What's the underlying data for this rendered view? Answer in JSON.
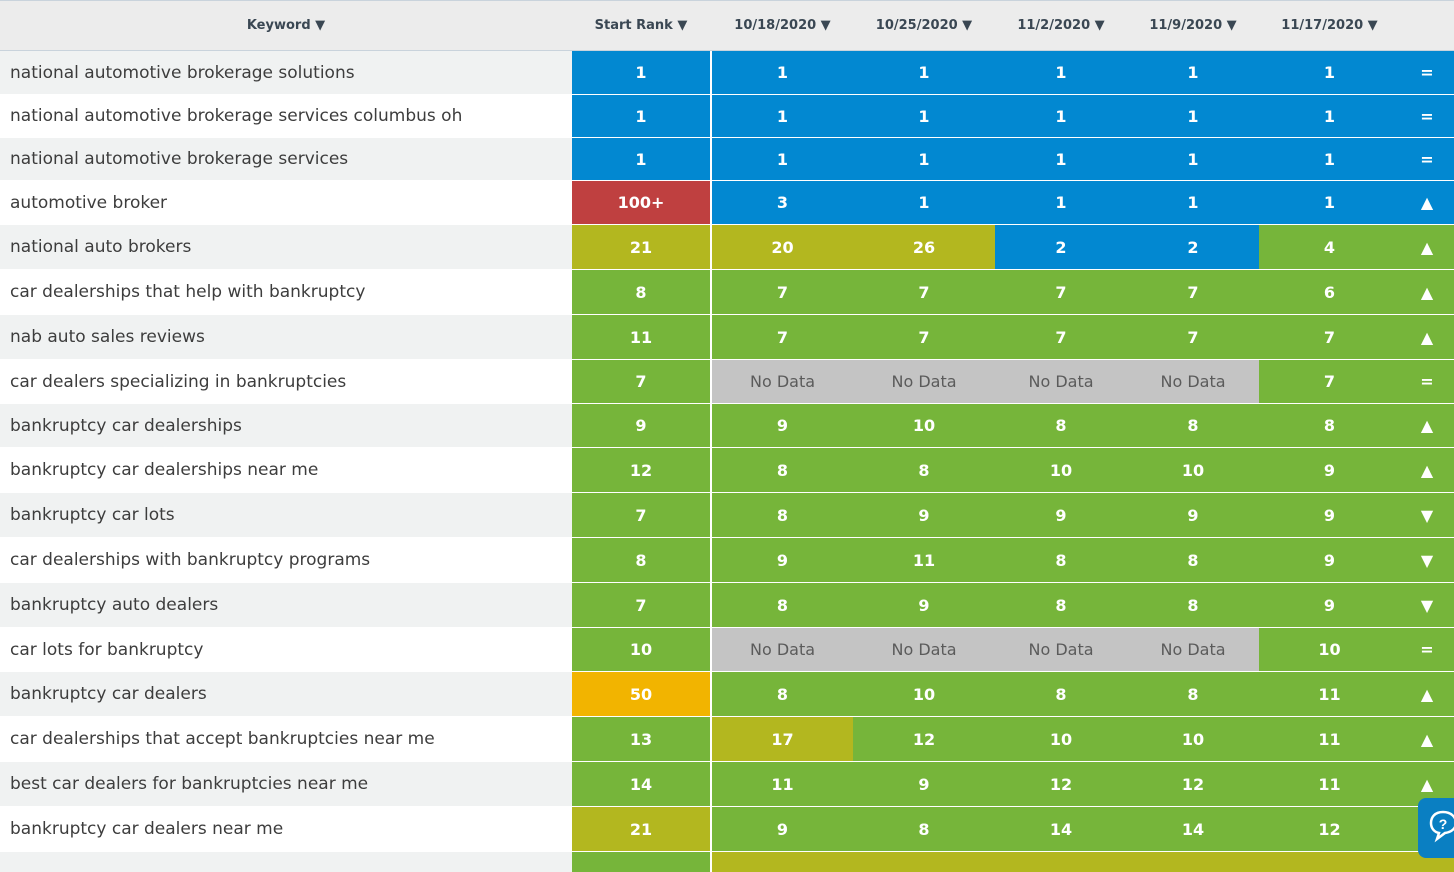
{
  "header": {
    "keyword": "Keyword ▼",
    "start_rank": "Start Rank ▼",
    "dates": [
      "10/18/2020 ▼",
      "10/25/2020 ▼",
      "11/2/2020 ▼",
      "11/9/2020 ▼",
      "11/17/2020 ▼"
    ]
  },
  "colors": {
    "blue": "#0288d1",
    "green": "#76b53a",
    "olive": "#b3b71f",
    "red": "#bf4040",
    "orange": "#f2b400",
    "gray": "#c4c4c4",
    "row_odd": "#f0f2f2",
    "row_even": "#ffffff"
  },
  "rows": [
    {
      "keyword": "national automotive brokerage solutions",
      "values": [
        "1",
        "1",
        "1",
        "1",
        "1",
        "1"
      ],
      "colors": [
        "blue",
        "blue",
        "blue",
        "blue",
        "blue",
        "blue"
      ],
      "trend": "=",
      "trend_color": "blue"
    },
    {
      "keyword": "national automotive brokerage services columbus oh",
      "values": [
        "1",
        "1",
        "1",
        "1",
        "1",
        "1"
      ],
      "colors": [
        "blue",
        "blue",
        "blue",
        "blue",
        "blue",
        "blue"
      ],
      "trend": "=",
      "trend_color": "blue"
    },
    {
      "keyword": "national automotive brokerage services",
      "values": [
        "1",
        "1",
        "1",
        "1",
        "1",
        "1"
      ],
      "colors": [
        "blue",
        "blue",
        "blue",
        "blue",
        "blue",
        "blue"
      ],
      "trend": "=",
      "trend_color": "blue"
    },
    {
      "keyword": "automotive broker",
      "values": [
        "100+",
        "3",
        "1",
        "1",
        "1",
        "1"
      ],
      "colors": [
        "red",
        "blue",
        "blue",
        "blue",
        "blue",
        "blue"
      ],
      "trend": "▲",
      "trend_color": "blue"
    },
    {
      "keyword": "national auto brokers",
      "values": [
        "21",
        "20",
        "26",
        "2",
        "2",
        "4"
      ],
      "colors": [
        "olive",
        "olive",
        "olive",
        "blue",
        "blue",
        "green"
      ],
      "trend": "▲",
      "trend_color": "green"
    },
    {
      "keyword": "car dealerships that help with bankruptcy",
      "values": [
        "8",
        "7",
        "7",
        "7",
        "7",
        "6"
      ],
      "colors": [
        "green",
        "green",
        "green",
        "green",
        "green",
        "green"
      ],
      "trend": "▲",
      "trend_color": "green"
    },
    {
      "keyword": "nab auto sales reviews",
      "values": [
        "11",
        "7",
        "7",
        "7",
        "7",
        "7"
      ],
      "colors": [
        "green",
        "green",
        "green",
        "green",
        "green",
        "green"
      ],
      "trend": "▲",
      "trend_color": "green"
    },
    {
      "keyword": "car dealers specializing in bankruptcies",
      "values": [
        "7",
        "No Data",
        "No Data",
        "No Data",
        "No Data",
        "7"
      ],
      "colors": [
        "green",
        "gray",
        "gray",
        "gray",
        "gray",
        "green"
      ],
      "trend": "=",
      "trend_color": "green"
    },
    {
      "keyword": "bankruptcy car dealerships",
      "values": [
        "9",
        "9",
        "10",
        "8",
        "8",
        "8"
      ],
      "colors": [
        "green",
        "green",
        "green",
        "green",
        "green",
        "green"
      ],
      "trend": "▲",
      "trend_color": "green"
    },
    {
      "keyword": "bankruptcy car dealerships near me",
      "values": [
        "12",
        "8",
        "8",
        "10",
        "10",
        "9"
      ],
      "colors": [
        "green",
        "green",
        "green",
        "green",
        "green",
        "green"
      ],
      "trend": "▲",
      "trend_color": "green"
    },
    {
      "keyword": "bankruptcy car lots",
      "values": [
        "7",
        "8",
        "9",
        "9",
        "9",
        "9"
      ],
      "colors": [
        "green",
        "green",
        "green",
        "green",
        "green",
        "green"
      ],
      "trend": "▼",
      "trend_color": "green"
    },
    {
      "keyword": "car dealerships with bankruptcy programs",
      "values": [
        "8",
        "9",
        "11",
        "8",
        "8",
        "9"
      ],
      "colors": [
        "green",
        "green",
        "green",
        "green",
        "green",
        "green"
      ],
      "trend": "▼",
      "trend_color": "green"
    },
    {
      "keyword": "bankruptcy auto dealers",
      "values": [
        "7",
        "8",
        "9",
        "8",
        "8",
        "9"
      ],
      "colors": [
        "green",
        "green",
        "green",
        "green",
        "green",
        "green"
      ],
      "trend": "▼",
      "trend_color": "green"
    },
    {
      "keyword": "car lots for bankruptcy",
      "values": [
        "10",
        "No Data",
        "No Data",
        "No Data",
        "No Data",
        "10"
      ],
      "colors": [
        "green",
        "gray",
        "gray",
        "gray",
        "gray",
        "green"
      ],
      "trend": "=",
      "trend_color": "green"
    },
    {
      "keyword": "bankruptcy car dealers",
      "values": [
        "50",
        "8",
        "10",
        "8",
        "8",
        "11"
      ],
      "colors": [
        "orange",
        "green",
        "green",
        "green",
        "green",
        "green"
      ],
      "trend": "▲",
      "trend_color": "green"
    },
    {
      "keyword": "car dealerships that accept bankruptcies near me",
      "values": [
        "13",
        "17",
        "12",
        "10",
        "10",
        "11"
      ],
      "colors": [
        "green",
        "olive",
        "green",
        "green",
        "green",
        "green"
      ],
      "trend": "▲",
      "trend_color": "green"
    },
    {
      "keyword": "best car dealers for bankruptcies near me",
      "values": [
        "14",
        "11",
        "9",
        "12",
        "12",
        "11"
      ],
      "colors": [
        "green",
        "green",
        "green",
        "green",
        "green",
        "green"
      ],
      "trend": "▲",
      "trend_color": "green"
    },
    {
      "keyword": "bankruptcy car dealers near me",
      "values": [
        "21",
        "9",
        "8",
        "14",
        "14",
        "12"
      ],
      "colors": [
        "olive",
        "green",
        "green",
        "green",
        "green",
        "green"
      ],
      "trend": "",
      "trend_color": "green"
    },
    {
      "keyword": "",
      "values": [
        "",
        "",
        "",
        "",
        "",
        ""
      ],
      "colors": [
        "green",
        "olive",
        "olive",
        "olive",
        "olive",
        "olive"
      ],
      "trend": "",
      "trend_color": "olive"
    }
  ],
  "help_icon": "help-chat-icon"
}
